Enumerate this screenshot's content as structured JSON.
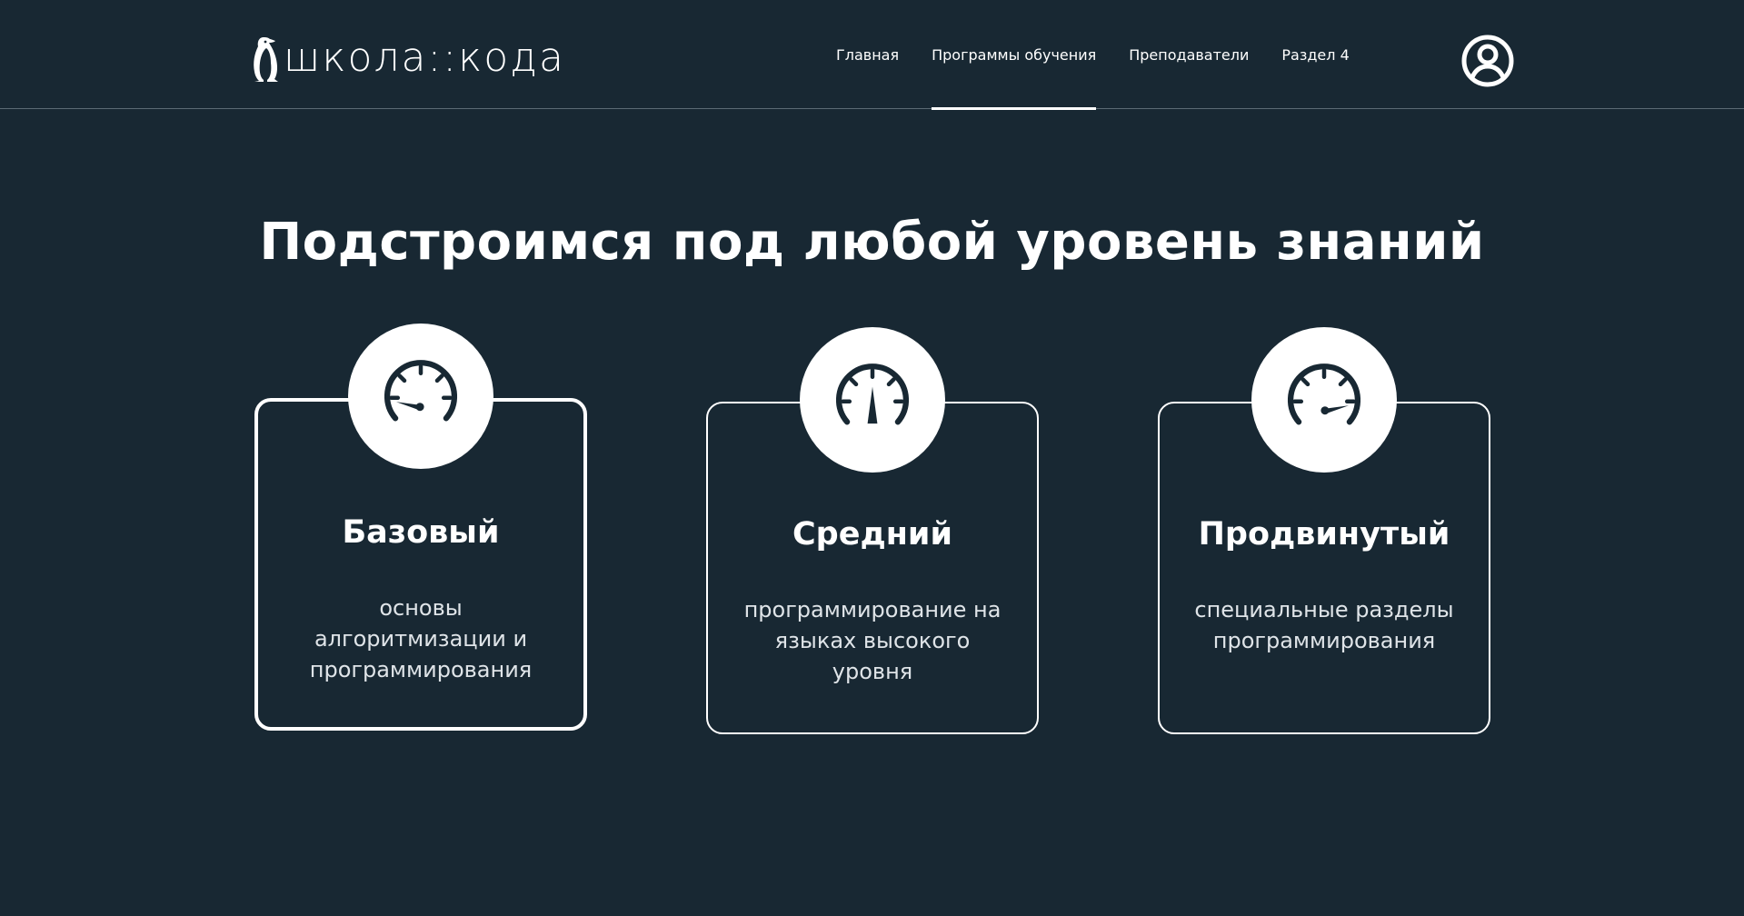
{
  "brand": {
    "logo_text": "школа::кода",
    "logo_icon": "penguin-icon"
  },
  "nav": {
    "items": [
      {
        "label": "Главная",
        "active": false
      },
      {
        "label": "Программы обучения",
        "active": true
      },
      {
        "label": "Преподаватели",
        "active": false
      },
      {
        "label": "Раздел 4",
        "active": false
      }
    ]
  },
  "profile_icon": "user-circle-icon",
  "headline": "Подстроимся под любой уровень знаний",
  "levels": [
    {
      "title": "Базовый",
      "description": "основы алгоритмизации и программирования",
      "icon": "speedometer-low-icon",
      "selected": true
    },
    {
      "title": "Средний",
      "description": "программирование на языках высокого уровня",
      "icon": "speedometer-medium-icon",
      "selected": false
    },
    {
      "title": "Продвинутый",
      "description": "специальные разделы программирования",
      "icon": "speedometer-high-icon",
      "selected": false
    }
  ],
  "colors": {
    "background": "#182833",
    "text": "#ffffff",
    "muted_text": "#dfe4e8"
  }
}
